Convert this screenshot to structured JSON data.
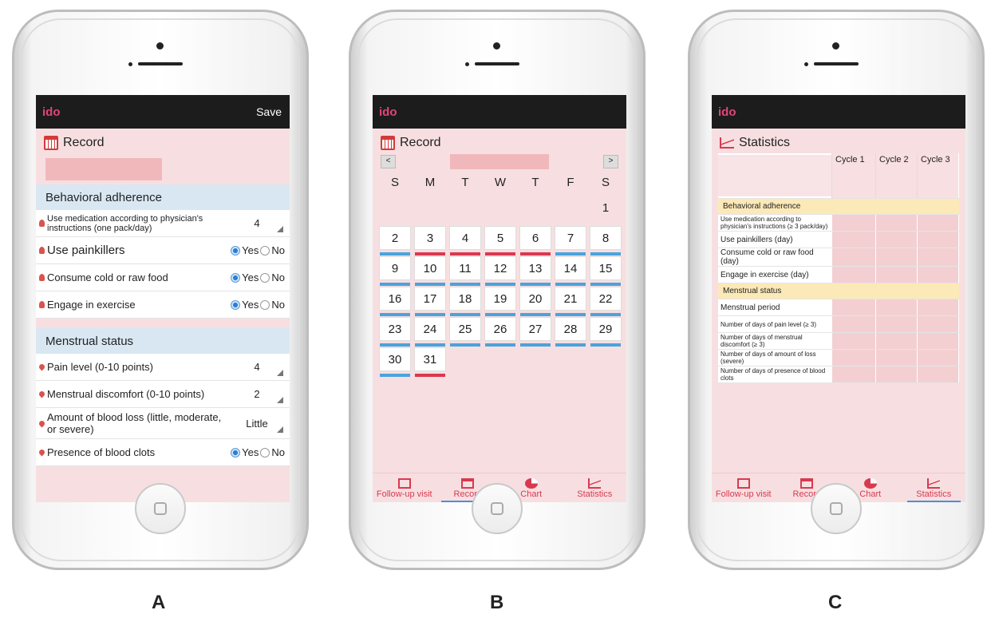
{
  "phoneA": {
    "app_logo": "ido",
    "save_label": "Save",
    "title": "Record",
    "sections": [
      {
        "heading": "Behavioral adherence",
        "rows": [
          {
            "label": "Use medication according to physician's instructions (one pack/day)",
            "type": "select",
            "value": "4"
          },
          {
            "label": "Use painkillers",
            "type": "radio",
            "selected": "Yes"
          },
          {
            "label": "Consume cold or raw food",
            "type": "radio",
            "selected": "Yes"
          },
          {
            "label": "Engage in exercise",
            "type": "radio",
            "selected": "Yes"
          }
        ]
      },
      {
        "heading": "Menstrual status",
        "rows": [
          {
            "label": "Pain level (0-10 points)",
            "type": "select",
            "value": "4"
          },
          {
            "label": "Menstrual discomfort (0-10 points)",
            "type": "select",
            "value": "2"
          },
          {
            "label": "Amount of blood loss (little, moderate, or severe)",
            "type": "select",
            "value": "Little"
          },
          {
            "label": "Presence of blood clots",
            "type": "radio",
            "selected": "Yes"
          }
        ]
      }
    ],
    "yes_label": "Yes",
    "no_label": "No",
    "caption": "A"
  },
  "phoneB": {
    "app_logo": "ido",
    "title": "Record",
    "prev": "<",
    "next": ">",
    "weekdays": [
      "S",
      "M",
      "T",
      "W",
      "T",
      "F",
      "S"
    ],
    "days": [
      {
        "d": "1",
        "bar": ""
      },
      {
        "d": "2",
        "bar": "blue"
      },
      {
        "d": "3",
        "bar": "red"
      },
      {
        "d": "4",
        "bar": "red"
      },
      {
        "d": "5",
        "bar": "red"
      },
      {
        "d": "6",
        "bar": "red"
      },
      {
        "d": "7",
        "bar": "blue"
      },
      {
        "d": "8",
        "bar": "blue"
      },
      {
        "d": "9",
        "bar": "blue"
      },
      {
        "d": "10",
        "bar": "blue"
      },
      {
        "d": "11",
        "bar": "blue"
      },
      {
        "d": "12",
        "bar": "blue"
      },
      {
        "d": "13",
        "bar": "blue"
      },
      {
        "d": "14",
        "bar": "blue"
      },
      {
        "d": "15",
        "bar": "blue"
      },
      {
        "d": "16",
        "bar": "blue"
      },
      {
        "d": "17",
        "bar": "blue"
      },
      {
        "d": "18",
        "bar": "blue"
      },
      {
        "d": "19",
        "bar": "blue"
      },
      {
        "d": "20",
        "bar": "blue"
      },
      {
        "d": "21",
        "bar": "blue"
      },
      {
        "d": "22",
        "bar": "blue"
      },
      {
        "d": "23",
        "bar": "blue"
      },
      {
        "d": "24",
        "bar": "blue"
      },
      {
        "d": "25",
        "bar": "blue"
      },
      {
        "d": "26",
        "bar": "blue"
      },
      {
        "d": "27",
        "bar": "blue"
      },
      {
        "d": "28",
        "bar": "blue"
      },
      {
        "d": "29",
        "bar": "blue"
      },
      {
        "d": "30",
        "bar": "blue"
      },
      {
        "d": "31",
        "bar": "red"
      }
    ],
    "caption": "B"
  },
  "phoneC": {
    "app_logo": "ido",
    "title": "Statistics",
    "cycles": [
      "Cycle 1",
      "Cycle 2",
      "Cycle 3"
    ],
    "behavioral_heading": "Behavioral adherence",
    "behavioral_rows": [
      "Use medication according to physician's instructions (≥ 3 pack/day)",
      "Use painkillers (day)",
      "Consume cold or raw food (day)",
      "Engage in exercise (day)"
    ],
    "menstrual_heading": "Menstrual status",
    "menstrual_rows": [
      "Menstrual period",
      "Number of days of pain level (≥ 3)",
      "Number of days  of menstrual discomfort (≥ 3)",
      "Number of days  of amount of loss (severe)",
      "Number of days  of presence of blood clots"
    ],
    "caption": "C"
  },
  "tabs": [
    "Follow-up visit",
    "Record",
    "Chart",
    "Statistics"
  ],
  "colors": {
    "accent": "#d9394f",
    "period_bar": "#d9394f",
    "normal_bar": "#4aa3dd",
    "section_bg": "#d9e7f3",
    "highlight": "#fbe9b8"
  }
}
